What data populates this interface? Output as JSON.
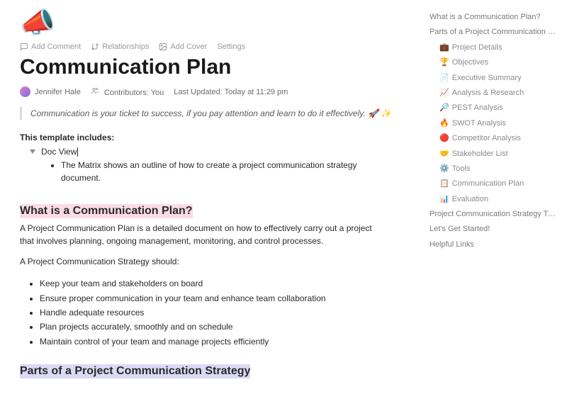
{
  "page_icon": "📣",
  "toolbar": {
    "add_comment": "Add Comment",
    "relationships": "Relationships",
    "add_cover": "Add Cover",
    "settings": "Settings"
  },
  "title": "Communication Plan",
  "meta": {
    "author": "Jennifer Hale",
    "contributors_label": "Contributors:",
    "contributors_value": "You",
    "last_updated_label": "Last Updated:",
    "last_updated_value": "Today at 11:29 pm"
  },
  "quote": "Communication is your ticket to success, if you pay attention and learn to do it effectively. 🚀 ✨",
  "includes": {
    "lead": "This template includes:",
    "doc_view": "Doc View",
    "matrix_desc": "The Matrix shows an outline of how to create a project communication strategy document."
  },
  "section_what": {
    "heading": "What is a Communication Plan?",
    "p1": "A Project Communication Plan is a detailed document on how to effectively carry out a project that involves planning, ongoing management, monitoring, and control processes.",
    "p2": "A Project Communication Strategy should:",
    "bullets": [
      "Keep your team and stakeholders on board",
      "Ensure proper communication in your team and enhance team collaboration",
      "Handle adequate resources",
      "Plan projects accurately, smoothly and on schedule",
      "Maintain control of your team and manage projects efficiently"
    ]
  },
  "section_parts": {
    "heading": "Parts of a Project Communication Strategy"
  },
  "outline": [
    {
      "label": "What is a Communication Plan?",
      "indent": 0,
      "emoji": ""
    },
    {
      "label": "Parts of a Project Communication St…",
      "indent": 0,
      "emoji": ""
    },
    {
      "label": "Project Details",
      "indent": 1,
      "emoji": "💼"
    },
    {
      "label": "Objectives",
      "indent": 1,
      "emoji": "🏆"
    },
    {
      "label": "Executive Summary",
      "indent": 1,
      "emoji": "📄"
    },
    {
      "label": "Analysis & Research",
      "indent": 1,
      "emoji": "📈"
    },
    {
      "label": "PEST Analysis",
      "indent": 1,
      "emoji": "🔎"
    },
    {
      "label": "SWOT Analysis",
      "indent": 1,
      "emoji": "🔥"
    },
    {
      "label": "Competitor Analysis",
      "indent": 1,
      "emoji": "🔴"
    },
    {
      "label": "Stakeholder List",
      "indent": 1,
      "emoji": "🤝"
    },
    {
      "label": "Tools",
      "indent": 1,
      "emoji": "⚙️"
    },
    {
      "label": "Communication Plan",
      "indent": 1,
      "emoji": "📋"
    },
    {
      "label": "Evaluation",
      "indent": 1,
      "emoji": "📊"
    },
    {
      "label": "Project Communication Strategy Tips!",
      "indent": 0,
      "emoji": ""
    },
    {
      "label": "Let's Get Started!",
      "indent": 0,
      "emoji": ""
    },
    {
      "label": "Helpful Links",
      "indent": 0,
      "emoji": ""
    }
  ]
}
